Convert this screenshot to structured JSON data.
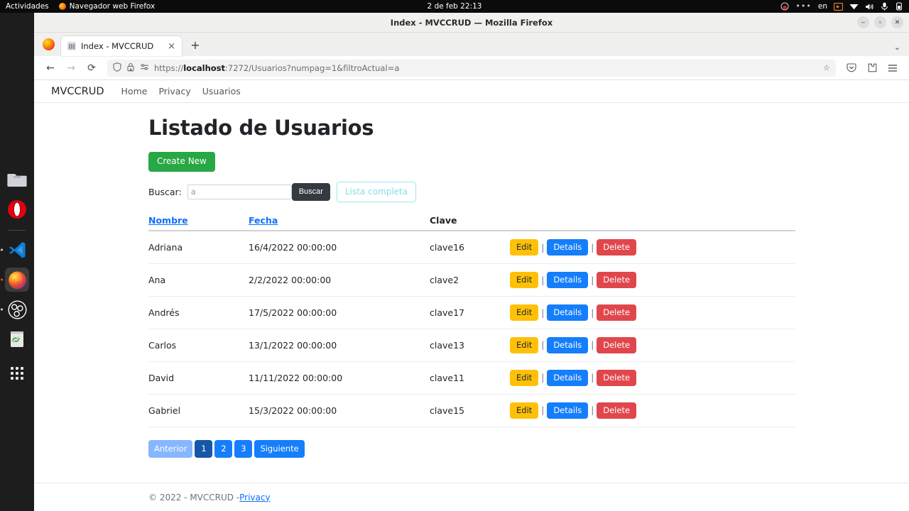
{
  "desktop": {
    "activities_label": "Actividades",
    "app_name": "Navegador web Firefox",
    "clock": "2 de feb  22:13",
    "language_indicator": "en",
    "tray_icons": [
      "recording-icon",
      "ellipsis-icon",
      "language-indicator",
      "screencast-icon",
      "wifi-icon",
      "volume-icon",
      "microphone-icon",
      "battery-icon"
    ],
    "dock_items": [
      {
        "name": "files",
        "icon": "folder-icon"
      },
      {
        "name": "opera",
        "icon": "opera-icon"
      },
      {
        "name": "vscode",
        "icon": "vscode-icon"
      },
      {
        "name": "firefox",
        "icon": "firefox-icon"
      },
      {
        "name": "obs-studio",
        "icon": "obs-icon"
      },
      {
        "name": "trash",
        "icon": "trash-icon"
      },
      {
        "name": "show-applications",
        "icon": "grid-icon"
      }
    ]
  },
  "window": {
    "title": "Index - MVCCRUD — Mozilla Firefox",
    "minimize_label": "–",
    "maximize_label": "▫",
    "close_label": "✕"
  },
  "browser": {
    "tab_title": "Index - MVCCRUD",
    "tab_close_label": "×",
    "new_tab_label": "+",
    "list_all_tabs_label": "⌄",
    "back_label": "←",
    "forward_label": "→",
    "reload_label": "⟳",
    "url_scheme": "https://",
    "url_host": "localhost",
    "url_rest": ":7272/Usuarios?numpag=1&filtroActual=a",
    "url_full": "https://localhost:7272/Usuarios?numpag=1&filtroActual=a",
    "bookmark_label": "☆",
    "toolbar_icons": [
      "shield-icon",
      "lock-warning-icon",
      "tracking-protection-icon",
      "pocket-icon",
      "extensions-icon",
      "app-menu-icon"
    ]
  },
  "site_nav": {
    "brand": "MVCCRUD",
    "links": [
      {
        "label": "Home"
      },
      {
        "label": "Privacy"
      },
      {
        "label": "Usuarios"
      }
    ]
  },
  "main": {
    "title": "Listado de Usuarios",
    "create_new_label": "Create New",
    "search": {
      "label": "Buscar:",
      "placeholder": "a",
      "value": "",
      "submit_label": "Buscar",
      "reset_label": "Lista completa"
    },
    "table": {
      "headers": [
        {
          "label": "Nombre",
          "sortable": true
        },
        {
          "label": "Fecha",
          "sortable": true
        },
        {
          "label": "Clave",
          "sortable": false
        },
        {
          "label": "",
          "sortable": false
        }
      ],
      "action_labels": {
        "edit": "Edit",
        "details": "Details",
        "delete": "Delete",
        "separator": "|"
      },
      "rows": [
        {
          "nombre": "Adriana",
          "fecha": "16/4/2022 00:00:00",
          "clave": "clave16"
        },
        {
          "nombre": "Ana",
          "fecha": "2/2/2022 00:00:00",
          "clave": "clave2"
        },
        {
          "nombre": "Andrés",
          "fecha": "17/5/2022 00:00:00",
          "clave": "clave17"
        },
        {
          "nombre": "Carlos",
          "fecha": "13/1/2022 00:00:00",
          "clave": "clave13"
        },
        {
          "nombre": "David",
          "fecha": "11/11/2022 00:00:00",
          "clave": "clave11"
        },
        {
          "nombre": "Gabriel",
          "fecha": "15/3/2022 00:00:00",
          "clave": "clave15"
        }
      ]
    },
    "pagination": [
      {
        "label": "Anterior",
        "state": "disabled"
      },
      {
        "label": "1",
        "state": "active"
      },
      {
        "label": "2",
        "state": "normal"
      },
      {
        "label": "3",
        "state": "normal"
      },
      {
        "label": "Siguiente",
        "state": "normal"
      }
    ]
  },
  "footer": {
    "text": "© 2022 - MVCCRUD - ",
    "privacy_label": "Privacy"
  },
  "colors": {
    "success": "#28a745",
    "warning": "#ffc107",
    "primary": "#157efb",
    "danger": "#e0474c",
    "dark": "#343a40",
    "info_outline": "#86dcea",
    "link": "#0d6efd",
    "page_active": "#1657a8",
    "page_disabled": "#86b7fe"
  }
}
